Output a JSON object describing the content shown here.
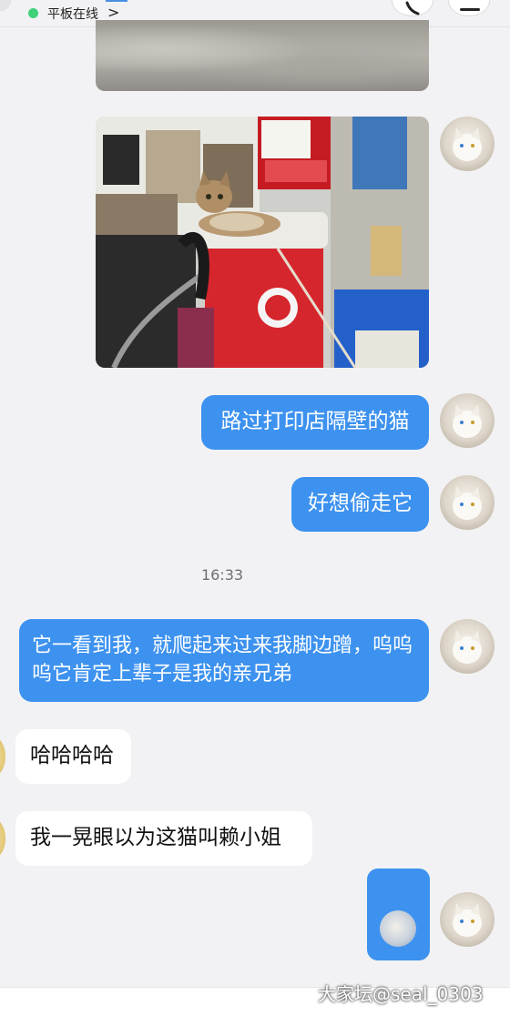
{
  "header": {
    "status_text": "平板在线",
    "chevron": ">",
    "online_color": "#3fd07a"
  },
  "messages": [
    {
      "type": "image",
      "side": "right",
      "description_icon": "photo"
    },
    {
      "type": "image",
      "side": "right",
      "description_icon": "photo"
    },
    {
      "type": "text",
      "side": "right",
      "text": "路过打印店隔壁的猫"
    },
    {
      "type": "text",
      "side": "right",
      "text": "好想偷走它"
    },
    {
      "type": "text",
      "side": "right",
      "text": "它一看到我，就爬起来过来我脚边蹭，呜呜呜它肯定上辈子是我的亲兄弟"
    },
    {
      "type": "text",
      "side": "left",
      "text": "哈哈哈哈"
    },
    {
      "type": "text",
      "side": "left",
      "text": "我一晃眼以为这猫叫赖小姐"
    },
    {
      "type": "sticker",
      "side": "right"
    }
  ],
  "timestamp": "16:33",
  "watermark": "大家坛@seal_0303",
  "colors": {
    "bubble_blue": "#3d92ef",
    "bubble_white": "#ffffff",
    "background": "#f2f2f4"
  }
}
